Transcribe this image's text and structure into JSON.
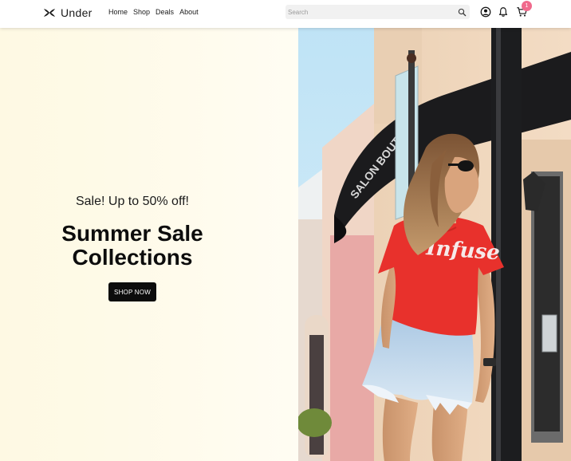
{
  "brand": {
    "name": "Under",
    "logo_icon": "under-armour-logo-icon"
  },
  "nav": {
    "links": [
      {
        "label": "Home"
      },
      {
        "label": "Shop"
      },
      {
        "label": "Deals"
      },
      {
        "label": "About"
      }
    ]
  },
  "search": {
    "placeholder": "Search",
    "value": "",
    "icon": "search-icon"
  },
  "actions": {
    "account_icon": "user-icon",
    "notifications_icon": "bell-icon",
    "cart_icon": "cart-icon",
    "cart_count": "1",
    "badge_color": "#f06a8c"
  },
  "hero": {
    "tagline": "Sale! Up to 50% off!",
    "title_line1": "Summer Sale",
    "title_line2": "Collections",
    "cta_label": "SHOP NOW",
    "photo_shirt_text": "Infuse",
    "photo_sign_text": "SALON BOUTIQUE",
    "background_color": "#fefae8",
    "cta_color": "#0c0c0c"
  }
}
